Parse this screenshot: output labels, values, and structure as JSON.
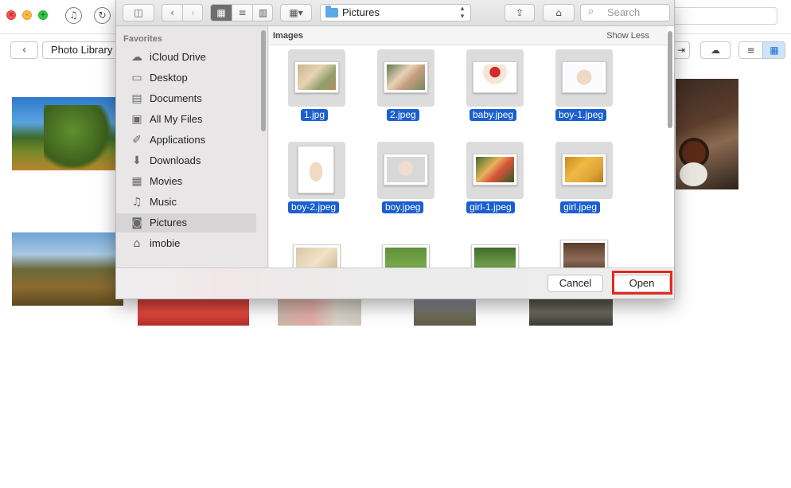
{
  "background_app": {
    "toolbar": {
      "back_glyph": "‹",
      "photo_library_label": "Photo Library"
    },
    "photos": [
      "forest-photo",
      "food-photo",
      "mountain-photo",
      "flowers-photo",
      "bag-photo",
      "lavender-photo",
      "rocks-photo"
    ]
  },
  "dialog": {
    "location": "Pictures",
    "search_placeholder": "Search",
    "sidebar": {
      "section": "Favorites",
      "items": [
        {
          "label": "iCloud Drive",
          "icon": "cloud-icon"
        },
        {
          "label": "Desktop",
          "icon": "desktop-icon"
        },
        {
          "label": "Documents",
          "icon": "documents-icon"
        },
        {
          "label": "All My Files",
          "icon": "all-files-icon"
        },
        {
          "label": "Applications",
          "icon": "applications-icon"
        },
        {
          "label": "Downloads",
          "icon": "downloads-icon"
        },
        {
          "label": "Movies",
          "icon": "movies-icon"
        },
        {
          "label": "Music",
          "icon": "music-icon"
        },
        {
          "label": "Pictures",
          "icon": "camera-icon",
          "selected": true
        },
        {
          "label": "imobie",
          "icon": "home-icon"
        }
      ]
    },
    "content": {
      "section_title": "Images",
      "toggle_label": "Show Less",
      "files": [
        "1.jpg",
        "2.jpeg",
        "baby.jpeg",
        "boy-1.jpeg",
        "boy-2.jpeg",
        "boy.jpeg",
        "girl-1.jpeg",
        "girl.jpeg"
      ]
    },
    "buttons": {
      "cancel": "Cancel",
      "open": "Open"
    }
  },
  "colors": {
    "selection": "#1a5fcf",
    "highlight_box": "#e5281f"
  }
}
